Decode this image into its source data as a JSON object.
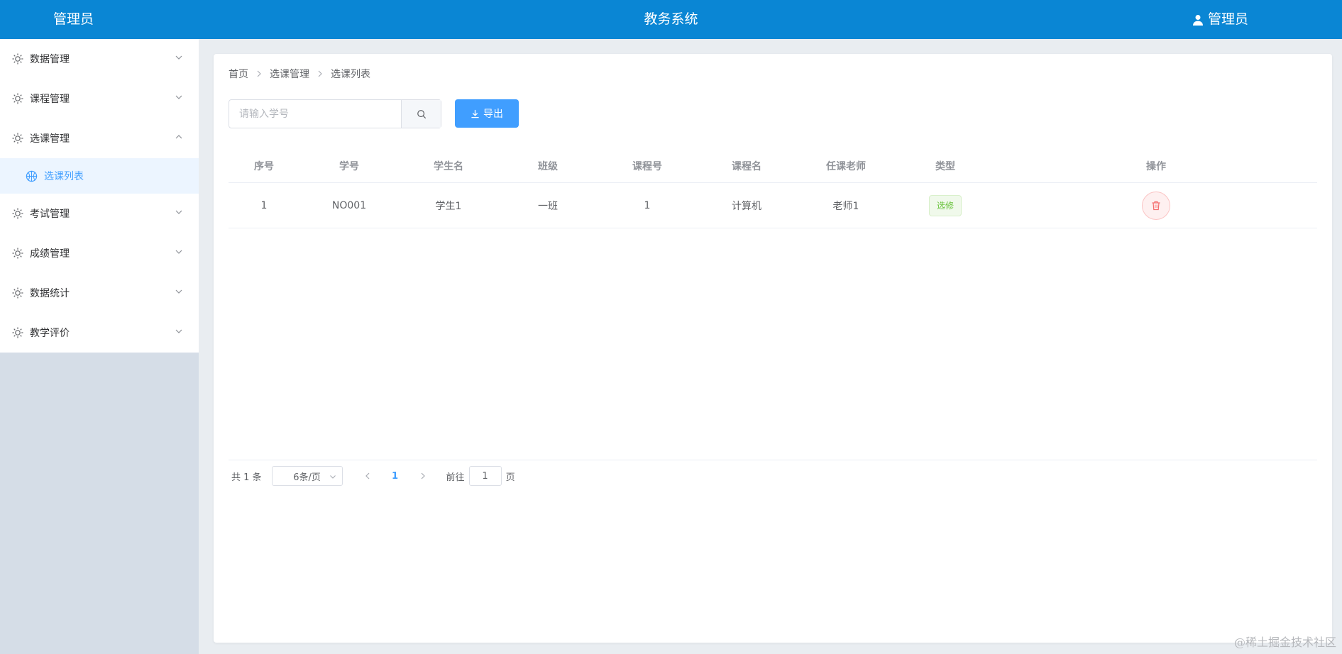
{
  "header": {
    "brand": "管理员",
    "title": "教务系统",
    "user_label": "管理员"
  },
  "sidebar": {
    "items": [
      {
        "label": "数据管理",
        "expanded": false
      },
      {
        "label": "课程管理",
        "expanded": false
      },
      {
        "label": "选课管理",
        "expanded": true
      },
      {
        "label": "考试管理",
        "expanded": false
      },
      {
        "label": "成绩管理",
        "expanded": false
      },
      {
        "label": "数据统计",
        "expanded": false
      },
      {
        "label": "教学评价",
        "expanded": false
      }
    ],
    "active_sub": "选课列表"
  },
  "breadcrumb": [
    "首页",
    "选课管理",
    "选课列表"
  ],
  "toolbar": {
    "search_placeholder": "请输入学号",
    "search_value": "",
    "export_label": "导出"
  },
  "table": {
    "columns": [
      "序号",
      "学号",
      "学生名",
      "班级",
      "课程号",
      "课程名",
      "任课老师",
      "类型",
      "操作"
    ],
    "rows": [
      {
        "index": "1",
        "student_no": "NO001",
        "student_name": "学生1",
        "class": "一班",
        "course_no": "1",
        "course_name": "计算机",
        "teacher": "老师1",
        "type": "选修"
      }
    ]
  },
  "pagination": {
    "total_text": "共 1 条",
    "page_size": "6条/页",
    "current_page": "1",
    "goto_label": "前往",
    "goto_value": "1",
    "page_suffix": "页"
  },
  "colors": {
    "header_bg": "#0a86d4",
    "primary": "#409eff",
    "success": "#67c23a",
    "danger": "#f56c6c"
  },
  "footer_watermark": "@稀土掘金技术社区"
}
